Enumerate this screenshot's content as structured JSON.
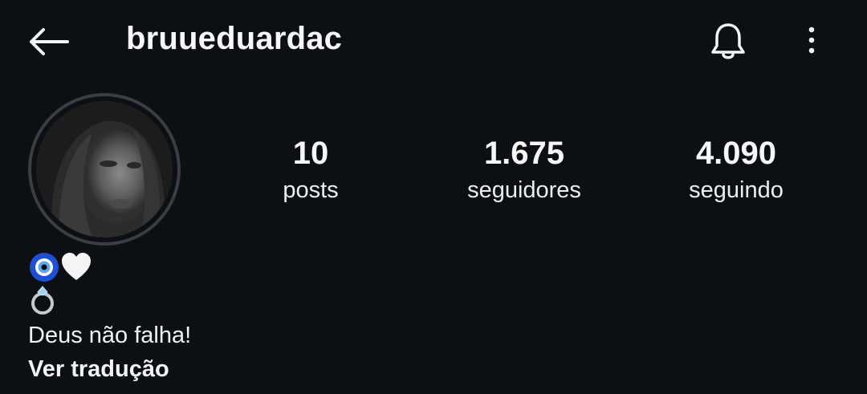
{
  "header": {
    "username": "bruueduardac",
    "back_icon": "arrow-left-icon",
    "notification_icon": "bell-icon",
    "more_icon": "more-vertical-icon"
  },
  "profile": {
    "avatar": "profile-photo"
  },
  "stats": [
    {
      "value": "10",
      "label": "posts"
    },
    {
      "value": "1.675",
      "label": "seguidores"
    },
    {
      "value": "4.090",
      "label": "seguindo"
    }
  ],
  "bio": {
    "emoji_line_1": [
      "nazar-amulet-emoji",
      "white-heart-emoji"
    ],
    "emoji_line_2": [
      "ring-emoji"
    ],
    "text": "Deus não falha!",
    "translate_label": "Ver tradução"
  },
  "colors": {
    "background": "#0c0f14",
    "text": "#f5f5f5",
    "avatar_ring": "#3a3d43"
  }
}
